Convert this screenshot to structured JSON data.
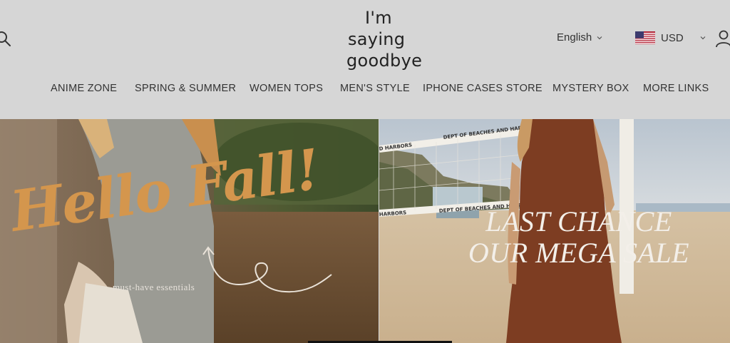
{
  "header": {
    "logo_lines": [
      "I'm",
      "saying",
      "goodbye"
    ],
    "language": "English",
    "currency": "USD",
    "icons": {
      "search": "search-icon",
      "user": "user-icon",
      "flag": "us-flag-icon",
      "chevron": "chevron-down-icon"
    }
  },
  "nav": {
    "items": [
      {
        "label": "ANIME ZONE"
      },
      {
        "label": "SPRING & SUMMER"
      },
      {
        "label": "WOMEN TOPS"
      },
      {
        "label": "MEN'S STYLE"
      },
      {
        "label": "IPHONE CASES STORE"
      },
      {
        "label": "MYSTERY BOX"
      },
      {
        "label": "MORE LINKS"
      }
    ]
  },
  "banners": {
    "left": {
      "title": "Hello Fall!",
      "tagline": "must-have essentials"
    },
    "right": {
      "title_lines": [
        "LAST CHANCE",
        "OUR MEGA SALE"
      ],
      "net_text": [
        "DEPT OF BEACHES AND HARBORS",
        "D HARBORS",
        "HARBORS",
        "DEPT OF BEACHES AND HARBORS"
      ]
    }
  },
  "colors": {
    "header_bg": "#d6d6d6",
    "hello_accent": "#d4964d",
    "text": "#333333"
  }
}
